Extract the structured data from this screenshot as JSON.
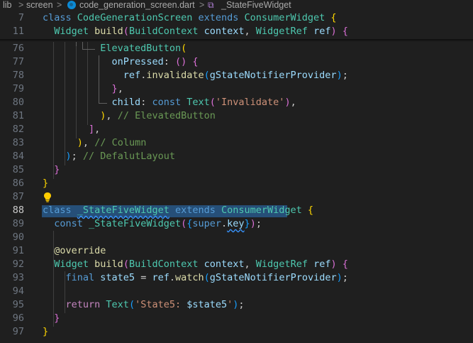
{
  "breadcrumb": {
    "items": [
      "lib",
      "screen",
      "code_generation_screen.dart",
      "_StateFiveWidget"
    ],
    "separator": ">"
  },
  "editor": {
    "active_line": "88",
    "lines": [
      {
        "n": "7",
        "tokens": [
          {
            "t": "class ",
            "c": "kw"
          },
          {
            "t": "CodeGenerationScreen ",
            "c": "type"
          },
          {
            "t": "extends ",
            "c": "kw"
          },
          {
            "t": "ConsumerWidget ",
            "c": "type"
          },
          {
            "t": "{",
            "c": "b1"
          }
        ]
      },
      {
        "n": "11",
        "tokens": [
          {
            "t": "  Widget ",
            "c": "type"
          },
          {
            "t": "build",
            "c": "fn"
          },
          {
            "t": "(",
            "c": "b2"
          },
          {
            "t": "BuildContext ",
            "c": "type"
          },
          {
            "t": "context",
            "c": "var"
          },
          {
            "t": ", ",
            "c": "p"
          },
          {
            "t": "WidgetRef ",
            "c": "type"
          },
          {
            "t": "ref",
            "c": "var"
          },
          {
            "t": ") ",
            "c": "b2"
          },
          {
            "t": "{",
            "c": "b2"
          }
        ]
      },
      {
        "n": "76",
        "tokens": [
          {
            "t": "          ",
            "c": "p"
          },
          {
            "t": "ElevatedButton",
            "c": "type"
          },
          {
            "t": "(",
            "c": "b1"
          }
        ]
      },
      {
        "n": "77",
        "tokens": [
          {
            "t": "            ",
            "c": "p"
          },
          {
            "t": "onPressed",
            "c": "var"
          },
          {
            "t": ": ",
            "c": "p"
          },
          {
            "t": "() ",
            "c": "b2"
          },
          {
            "t": "{",
            "c": "b2"
          }
        ]
      },
      {
        "n": "78",
        "tokens": [
          {
            "t": "              ",
            "c": "p"
          },
          {
            "t": "ref",
            "c": "var"
          },
          {
            "t": ".",
            "c": "p"
          },
          {
            "t": "invalidate",
            "c": "fn"
          },
          {
            "t": "(",
            "c": "b3"
          },
          {
            "t": "gStateNotifierProvider",
            "c": "var"
          },
          {
            "t": ")",
            "c": "b3"
          },
          {
            "t": ";",
            "c": "p"
          }
        ]
      },
      {
        "n": "79",
        "tokens": [
          {
            "t": "            ",
            "c": "p"
          },
          {
            "t": "}",
            "c": "b2"
          },
          {
            "t": ",",
            "c": "p"
          }
        ]
      },
      {
        "n": "80",
        "tokens": [
          {
            "t": "            ",
            "c": "p"
          },
          {
            "t": "child",
            "c": "var"
          },
          {
            "t": ": ",
            "c": "p"
          },
          {
            "t": "const ",
            "c": "kw"
          },
          {
            "t": "Text",
            "c": "type"
          },
          {
            "t": "(",
            "c": "b2"
          },
          {
            "t": "'Invalidate'",
            "c": "str"
          },
          {
            "t": ")",
            "c": "b2"
          },
          {
            "t": ",",
            "c": "p"
          }
        ]
      },
      {
        "n": "81",
        "tokens": [
          {
            "t": "          ",
            "c": "p"
          },
          {
            "t": ")",
            "c": "b1"
          },
          {
            "t": ", ",
            "c": "p"
          },
          {
            "t": "// ElevatedButton",
            "c": "cm"
          }
        ]
      },
      {
        "n": "82",
        "tokens": [
          {
            "t": "        ",
            "c": "p"
          },
          {
            "t": "]",
            "c": "b2"
          },
          {
            "t": ",",
            "c": "p"
          }
        ]
      },
      {
        "n": "83",
        "tokens": [
          {
            "t": "      ",
            "c": "p"
          },
          {
            "t": ")",
            "c": "b1"
          },
          {
            "t": ", ",
            "c": "p"
          },
          {
            "t": "// Column",
            "c": "cm"
          }
        ]
      },
      {
        "n": "84",
        "tokens": [
          {
            "t": "    ",
            "c": "p"
          },
          {
            "t": ")",
            "c": "b3"
          },
          {
            "t": "; ",
            "c": "p"
          },
          {
            "t": "// DefalutLayout",
            "c": "cm"
          }
        ]
      },
      {
        "n": "85",
        "tokens": [
          {
            "t": "  ",
            "c": "p"
          },
          {
            "t": "}",
            "c": "b2"
          }
        ]
      },
      {
        "n": "86",
        "tokens": [
          {
            "t": "}",
            "c": "b1"
          }
        ]
      },
      {
        "n": "87",
        "tokens": []
      },
      {
        "n": "88",
        "tokens": [
          {
            "t": "class ",
            "c": "kw"
          },
          {
            "t": "_StateFiveWidget",
            "c": "type",
            "sq": true
          },
          {
            "t": " extends ",
            "c": "kw"
          },
          {
            "t": "ConsumerWidget ",
            "c": "type"
          },
          {
            "t": "{",
            "c": "b1"
          }
        ]
      },
      {
        "n": "89",
        "tokens": [
          {
            "t": "  ",
            "c": "p"
          },
          {
            "t": "const ",
            "c": "kw"
          },
          {
            "t": "_StateFiveWidget",
            "c": "type"
          },
          {
            "t": "(",
            "c": "b2"
          },
          {
            "t": "{",
            "c": "b3"
          },
          {
            "t": "super",
            "c": "kw"
          },
          {
            "t": ".",
            "c": "p"
          },
          {
            "t": "key",
            "c": "var",
            "sq": true
          },
          {
            "t": "}",
            "c": "b3"
          },
          {
            "t": ")",
            "c": "b2"
          },
          {
            "t": ";",
            "c": "p"
          }
        ]
      },
      {
        "n": "90",
        "tokens": []
      },
      {
        "n": "91",
        "tokens": [
          {
            "t": "  ",
            "c": "p"
          },
          {
            "t": "@override",
            "c": "fn"
          }
        ]
      },
      {
        "n": "92",
        "tokens": [
          {
            "t": "  ",
            "c": "p"
          },
          {
            "t": "Widget ",
            "c": "type"
          },
          {
            "t": "build",
            "c": "fn"
          },
          {
            "t": "(",
            "c": "b2"
          },
          {
            "t": "BuildContext ",
            "c": "type"
          },
          {
            "t": "context",
            "c": "var"
          },
          {
            "t": ", ",
            "c": "p"
          },
          {
            "t": "WidgetRef ",
            "c": "type"
          },
          {
            "t": "ref",
            "c": "var"
          },
          {
            "t": ") ",
            "c": "b2"
          },
          {
            "t": "{",
            "c": "b2"
          }
        ]
      },
      {
        "n": "93",
        "tokens": [
          {
            "t": "    ",
            "c": "p"
          },
          {
            "t": "final ",
            "c": "kw"
          },
          {
            "t": "state5 ",
            "c": "var"
          },
          {
            "t": "= ",
            "c": "p"
          },
          {
            "t": "ref",
            "c": "var"
          },
          {
            "t": ".",
            "c": "p"
          },
          {
            "t": "watch",
            "c": "fn"
          },
          {
            "t": "(",
            "c": "b3"
          },
          {
            "t": "gStateNotifierProvider",
            "c": "var"
          },
          {
            "t": ")",
            "c": "b3"
          },
          {
            "t": ";",
            "c": "p"
          }
        ]
      },
      {
        "n": "94",
        "tokens": []
      },
      {
        "n": "95",
        "tokens": [
          {
            "t": "    ",
            "c": "p"
          },
          {
            "t": "return ",
            "c": "ctrl"
          },
          {
            "t": "Text",
            "c": "type"
          },
          {
            "t": "(",
            "c": "b3"
          },
          {
            "t": "'State5: ",
            "c": "str"
          },
          {
            "t": "$state5",
            "c": "var"
          },
          {
            "t": "'",
            "c": "str"
          },
          {
            "t": ")",
            "c": "b3"
          },
          {
            "t": ";",
            "c": "p"
          }
        ]
      },
      {
        "n": "96",
        "tokens": [
          {
            "t": "  ",
            "c": "p"
          },
          {
            "t": "}",
            "c": "b2"
          }
        ]
      },
      {
        "n": "97",
        "tokens": [
          {
            "t": "}",
            "c": "b1"
          }
        ]
      }
    ]
  },
  "icons": {
    "file": "dart-file-icon",
    "symbol": "class-symbol-icon",
    "lightbulb": "lightbulb-icon"
  },
  "colors": {
    "background": "#1f1f1f",
    "selection": "#264f78",
    "keyword": "#569cd6",
    "type": "#4ec9b0",
    "function": "#dcdcaa",
    "variable": "#9cdcfe",
    "string": "#ce9178",
    "comment": "#6a9955"
  }
}
